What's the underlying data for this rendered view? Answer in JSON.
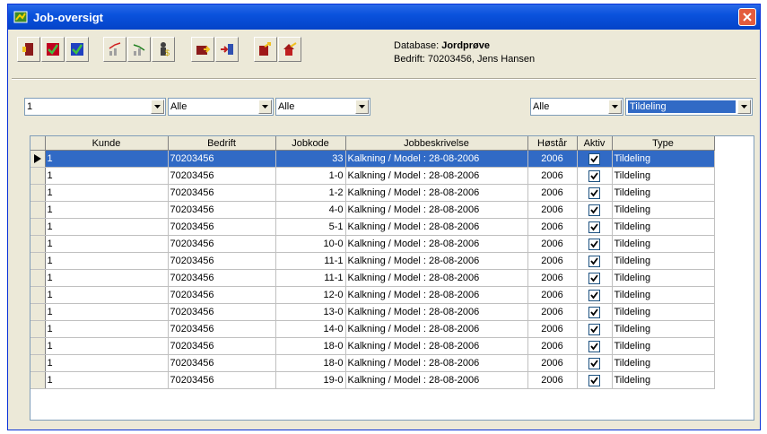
{
  "window": {
    "title": "Job-oversigt"
  },
  "toolbar": {
    "buttons": [
      {
        "icon": "exit-door-icon"
      },
      {
        "icon": "checkmark-red-icon"
      },
      {
        "icon": "checkmark-blue-icon"
      },
      {
        "icon": "chart-up-icon"
      },
      {
        "icon": "chart-down-icon"
      },
      {
        "icon": "person-dollar-icon"
      },
      {
        "icon": "folder-arrow-icon"
      },
      {
        "icon": "import-arrow-icon"
      },
      {
        "icon": "book-export-icon"
      },
      {
        "icon": "house-export-icon"
      }
    ]
  },
  "database": {
    "label": "Database:",
    "name": "Jordprøve",
    "company_line": "Bedrift: 70203456, Jens Hansen"
  },
  "filters": {
    "filter1": "1",
    "filter2": "Alle",
    "filter3": "Alle",
    "filter4": "Alle",
    "filter5": "Tildeling"
  },
  "table": {
    "columns": [
      "Kunde",
      "Bedrift",
      "Jobkode",
      "Jobbeskrivelse",
      "Høstår",
      "Aktiv",
      "Type"
    ],
    "rows": [
      {
        "kunde": "1",
        "bedrift": "70203456",
        "jobkode": "33",
        "beskrivelse": "Kalkning / Model : 28-08-2006",
        "hostar": "2006",
        "aktiv": true,
        "type": "Tildeling",
        "selected": true
      },
      {
        "kunde": "1",
        "bedrift": "70203456",
        "jobkode": "1-0",
        "beskrivelse": "Kalkning / Model : 28-08-2006",
        "hostar": "2006",
        "aktiv": true,
        "type": "Tildeling"
      },
      {
        "kunde": "1",
        "bedrift": "70203456",
        "jobkode": "1-2",
        "beskrivelse": "Kalkning / Model : 28-08-2006",
        "hostar": "2006",
        "aktiv": true,
        "type": "Tildeling"
      },
      {
        "kunde": "1",
        "bedrift": "70203456",
        "jobkode": "4-0",
        "beskrivelse": "Kalkning / Model : 28-08-2006",
        "hostar": "2006",
        "aktiv": true,
        "type": "Tildeling"
      },
      {
        "kunde": "1",
        "bedrift": "70203456",
        "jobkode": "5-1",
        "beskrivelse": "Kalkning / Model : 28-08-2006",
        "hostar": "2006",
        "aktiv": true,
        "type": "Tildeling"
      },
      {
        "kunde": "1",
        "bedrift": "70203456",
        "jobkode": "10-0",
        "beskrivelse": "Kalkning / Model : 28-08-2006",
        "hostar": "2006",
        "aktiv": true,
        "type": "Tildeling"
      },
      {
        "kunde": "1",
        "bedrift": "70203456",
        "jobkode": "11-1",
        "beskrivelse": "Kalkning / Model : 28-08-2006",
        "hostar": "2006",
        "aktiv": true,
        "type": "Tildeling"
      },
      {
        "kunde": "1",
        "bedrift": "70203456",
        "jobkode": "11-1",
        "beskrivelse": "Kalkning / Model : 28-08-2006",
        "hostar": "2006",
        "aktiv": true,
        "type": "Tildeling"
      },
      {
        "kunde": "1",
        "bedrift": "70203456",
        "jobkode": "12-0",
        "beskrivelse": "Kalkning / Model : 28-08-2006",
        "hostar": "2006",
        "aktiv": true,
        "type": "Tildeling"
      },
      {
        "kunde": "1",
        "bedrift": "70203456",
        "jobkode": "13-0",
        "beskrivelse": "Kalkning / Model : 28-08-2006",
        "hostar": "2006",
        "aktiv": true,
        "type": "Tildeling"
      },
      {
        "kunde": "1",
        "bedrift": "70203456",
        "jobkode": "14-0",
        "beskrivelse": "Kalkning / Model : 28-08-2006",
        "hostar": "2006",
        "aktiv": true,
        "type": "Tildeling"
      },
      {
        "kunde": "1",
        "bedrift": "70203456",
        "jobkode": "18-0",
        "beskrivelse": "Kalkning / Model : 28-08-2006",
        "hostar": "2006",
        "aktiv": true,
        "type": "Tildeling"
      },
      {
        "kunde": "1",
        "bedrift": "70203456",
        "jobkode": "18-0",
        "beskrivelse": "Kalkning / Model : 28-08-2006",
        "hostar": "2006",
        "aktiv": true,
        "type": "Tildeling"
      },
      {
        "kunde": "1",
        "bedrift": "70203456",
        "jobkode": "19-0",
        "beskrivelse": "Kalkning / Model : 28-08-2006",
        "hostar": "2006",
        "aktiv": true,
        "type": "Tildeling"
      }
    ]
  }
}
